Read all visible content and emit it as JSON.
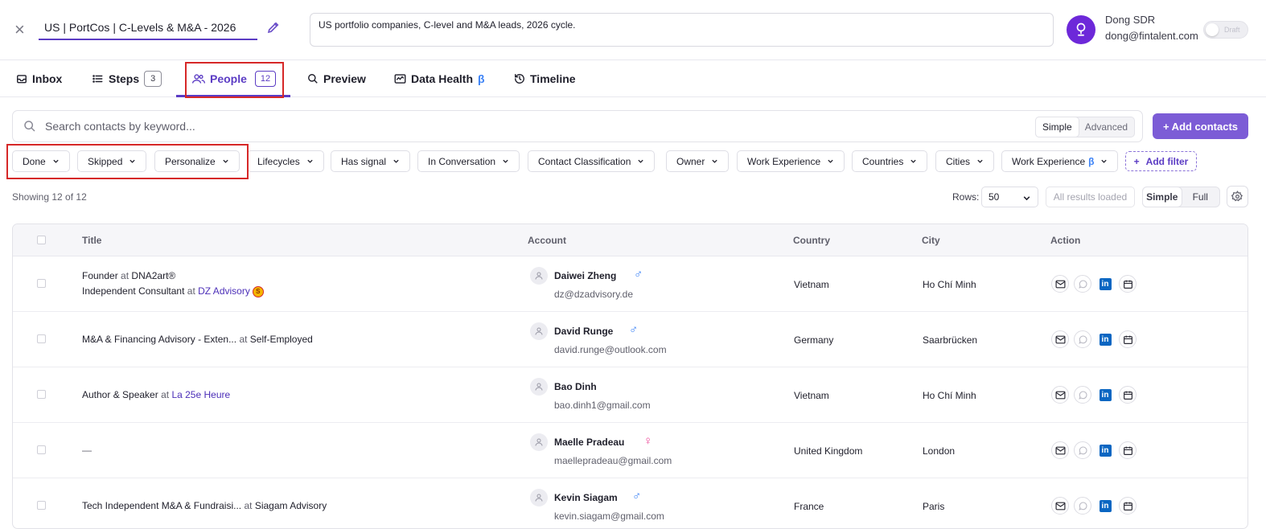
{
  "header": {
    "close_glyph": "×",
    "campaign_title": "US | PortCos | C-Levels & M&A - 2026",
    "description": "US portfolio companies, C-level and M&A leads, 2026 cycle.",
    "user_name": "Dong SDR",
    "user_email": "dong@fintalent.com",
    "toggle_label": "Draft",
    "accent_color": "#5b3cc4"
  },
  "tabs": [
    {
      "label": "Inbox",
      "icon": "inbox-icon"
    },
    {
      "label": "Steps",
      "icon": "list-icon",
      "count": "3"
    },
    {
      "label": "People",
      "icon": "people-icon",
      "count": "12",
      "active": true
    },
    {
      "label": "Preview",
      "icon": "search-icon"
    },
    {
      "label": "Data Health",
      "icon": "health-icon",
      "beta": "β"
    },
    {
      "label": "Timeline",
      "icon": "history-icon"
    }
  ],
  "search": {
    "placeholder": "Search contacts by keyword...",
    "mode_simple": "Simple",
    "mode_advanced": "Advanced",
    "add_contacts": "+ Add contacts"
  },
  "filters": [
    "Done",
    "Skipped",
    "Personalize",
    "Lifecycles",
    "Has signal",
    "In Conversation",
    "Contact Classification",
    "Owner",
    "Work Experience",
    "Countries",
    "Cities",
    "Work Experience"
  ],
  "filter_beta": "β",
  "add_filter": "Add filter",
  "add_filter_plus": "+",
  "results": {
    "showing": "Showing 12 of 12",
    "rows_label": "Rows:",
    "rows_value": "50",
    "all_loaded": "All results loaded",
    "view_simple": "Simple",
    "view_full": "Full"
  },
  "table": {
    "headers": [
      "Title",
      "Account",
      "Country",
      "City",
      "Action"
    ],
    "rows": [
      {
        "title1": "Founder",
        "at1": "at",
        "company1": "DNA2art®",
        "company1_link": false,
        "title2": "Independent Consultant",
        "at2": "at",
        "company2": "DZ Advisory",
        "badge": "S",
        "name": "Daiwei Zheng",
        "gender": "♂",
        "gender_type": "male",
        "email": "dz@dzadvisory.de",
        "country": "Vietnam",
        "city": "Ho Chí Minh"
      },
      {
        "title1": "M&A & Financing Advisory - Exten...",
        "at1": "at",
        "company1": "Self-Employed",
        "company1_link": false,
        "name": "David Runge",
        "gender": "♂",
        "gender_type": "male",
        "email": "david.runge@outlook.com",
        "country": "Germany",
        "city": "Saarbrücken"
      },
      {
        "title1": "Author & Speaker",
        "at1": "at",
        "company1": "La 25e Heure",
        "company1_link": true,
        "name": "Bao Dinh",
        "email": "bao.dinh1@gmail.com",
        "country": "Vietnam",
        "city": "Ho Chí Minh"
      },
      {
        "title1": "—",
        "name": "Maelle Pradeau",
        "gender": "♀",
        "gender_type": "female",
        "email": "maellepradeau@gmail.com",
        "country": "United Kingdom",
        "city": "London"
      },
      {
        "title1": "Tech Independent M&A & Fundraisi...",
        "at1": "at",
        "company1": "Siagam Advisory",
        "company1_link": false,
        "name": "Kevin Siagam",
        "gender": "♂",
        "gender_type": "male",
        "email": "kevin.siagam@gmail.com",
        "country": "France",
        "city": "Paris"
      }
    ],
    "linkedin_glyph": "in"
  }
}
